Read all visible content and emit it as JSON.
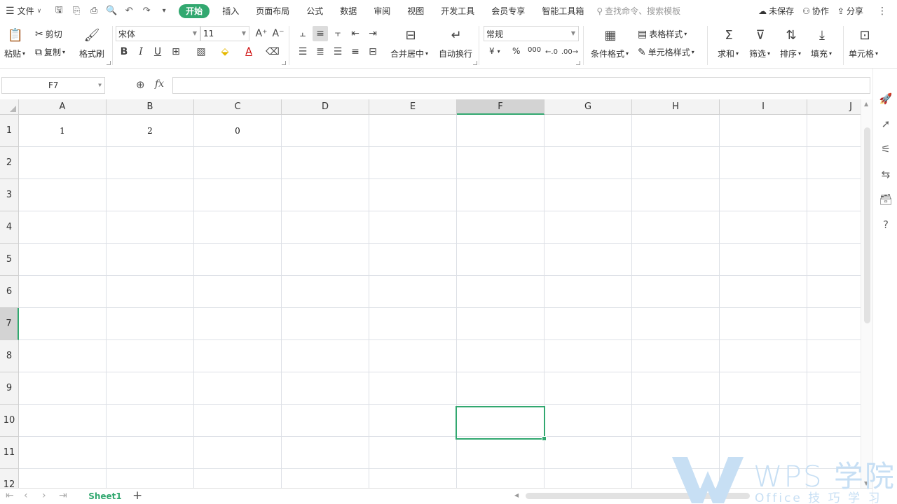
{
  "menubar": {
    "file_label": "文件",
    "tabs": [
      {
        "label": "开始",
        "active": true
      },
      {
        "label": "插入"
      },
      {
        "label": "页面布局"
      },
      {
        "label": "公式"
      },
      {
        "label": "数据"
      },
      {
        "label": "审阅"
      },
      {
        "label": "视图"
      },
      {
        "label": "开发工具"
      },
      {
        "label": "会员专享"
      },
      {
        "label": "智能工具箱"
      }
    ],
    "search_placeholder": "查找命令、搜索模板",
    "unsaved_label": "未保存",
    "collab_label": "协作",
    "share_label": "分享"
  },
  "ribbon": {
    "paste": "粘贴",
    "cut": "剪切",
    "copy": "复制",
    "format_painter": "格式刷",
    "font_name": "宋体",
    "font_size": "11",
    "merge_center": "合并居中",
    "wrap_text": "自动换行",
    "number_format": "常规",
    "conditional_format": "条件格式",
    "table_style": "表格样式",
    "cell_style": "单元格样式",
    "sum": "求和",
    "filter": "筛选",
    "sort": "排序",
    "fill": "填充",
    "cells": "单元格",
    "currency_symbol": "¥",
    "percent_symbol": "%",
    "thousands_symbol": "000"
  },
  "formula_bar": {
    "name_box": "F7",
    "fx_label": "fx",
    "formula": ""
  },
  "grid": {
    "columns": [
      "A",
      "B",
      "C",
      "D",
      "E",
      "F",
      "G",
      "H",
      "I",
      "J"
    ],
    "rows": [
      "1",
      "2",
      "3",
      "4",
      "5",
      "6",
      "7",
      "8",
      "9",
      "10",
      "11",
      "12"
    ],
    "selected_cell": "F7",
    "cells": {
      "A1": "1",
      "B1": "2",
      "C1": "0"
    }
  },
  "sheets": {
    "tabs": [
      "Sheet1"
    ],
    "active": "Sheet1",
    "add_label": "+"
  },
  "watermark": {
    "title": "WPS 学院",
    "subtitle": "Office 技 巧 学 习 平 台"
  },
  "colors": {
    "accent": "#32a870",
    "gridline": "#dde0e6",
    "header_bg": "#f3f3f3",
    "watermark": "#c7dff4"
  }
}
